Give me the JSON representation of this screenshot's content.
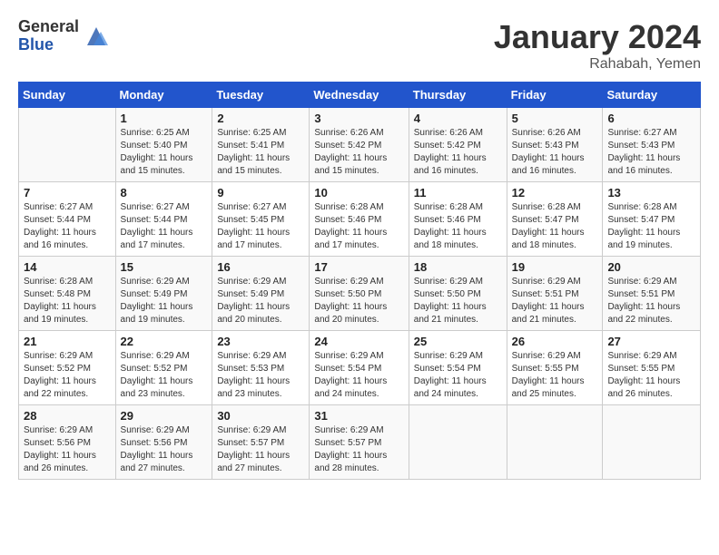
{
  "logo": {
    "general": "General",
    "blue": "Blue"
  },
  "title": "January 2024",
  "location": "Rahabah, Yemen",
  "days_of_week": [
    "Sunday",
    "Monday",
    "Tuesday",
    "Wednesday",
    "Thursday",
    "Friday",
    "Saturday"
  ],
  "weeks": [
    [
      {
        "day": "",
        "sunrise": "",
        "sunset": "",
        "daylight": ""
      },
      {
        "day": "1",
        "sunrise": "6:25 AM",
        "sunset": "5:40 PM",
        "daylight": "11 hours and 15 minutes."
      },
      {
        "day": "2",
        "sunrise": "6:25 AM",
        "sunset": "5:41 PM",
        "daylight": "11 hours and 15 minutes."
      },
      {
        "day": "3",
        "sunrise": "6:26 AM",
        "sunset": "5:42 PM",
        "daylight": "11 hours and 15 minutes."
      },
      {
        "day": "4",
        "sunrise": "6:26 AM",
        "sunset": "5:42 PM",
        "daylight": "11 hours and 16 minutes."
      },
      {
        "day": "5",
        "sunrise": "6:26 AM",
        "sunset": "5:43 PM",
        "daylight": "11 hours and 16 minutes."
      },
      {
        "day": "6",
        "sunrise": "6:27 AM",
        "sunset": "5:43 PM",
        "daylight": "11 hours and 16 minutes."
      }
    ],
    [
      {
        "day": "7",
        "sunrise": "6:27 AM",
        "sunset": "5:44 PM",
        "daylight": "11 hours and 16 minutes."
      },
      {
        "day": "8",
        "sunrise": "6:27 AM",
        "sunset": "5:44 PM",
        "daylight": "11 hours and 17 minutes."
      },
      {
        "day": "9",
        "sunrise": "6:27 AM",
        "sunset": "5:45 PM",
        "daylight": "11 hours and 17 minutes."
      },
      {
        "day": "10",
        "sunrise": "6:28 AM",
        "sunset": "5:46 PM",
        "daylight": "11 hours and 17 minutes."
      },
      {
        "day": "11",
        "sunrise": "6:28 AM",
        "sunset": "5:46 PM",
        "daylight": "11 hours and 18 minutes."
      },
      {
        "day": "12",
        "sunrise": "6:28 AM",
        "sunset": "5:47 PM",
        "daylight": "11 hours and 18 minutes."
      },
      {
        "day": "13",
        "sunrise": "6:28 AM",
        "sunset": "5:47 PM",
        "daylight": "11 hours and 19 minutes."
      }
    ],
    [
      {
        "day": "14",
        "sunrise": "6:28 AM",
        "sunset": "5:48 PM",
        "daylight": "11 hours and 19 minutes."
      },
      {
        "day": "15",
        "sunrise": "6:29 AM",
        "sunset": "5:49 PM",
        "daylight": "11 hours and 19 minutes."
      },
      {
        "day": "16",
        "sunrise": "6:29 AM",
        "sunset": "5:49 PM",
        "daylight": "11 hours and 20 minutes."
      },
      {
        "day": "17",
        "sunrise": "6:29 AM",
        "sunset": "5:50 PM",
        "daylight": "11 hours and 20 minutes."
      },
      {
        "day": "18",
        "sunrise": "6:29 AM",
        "sunset": "5:50 PM",
        "daylight": "11 hours and 21 minutes."
      },
      {
        "day": "19",
        "sunrise": "6:29 AM",
        "sunset": "5:51 PM",
        "daylight": "11 hours and 21 minutes."
      },
      {
        "day": "20",
        "sunrise": "6:29 AM",
        "sunset": "5:51 PM",
        "daylight": "11 hours and 22 minutes."
      }
    ],
    [
      {
        "day": "21",
        "sunrise": "6:29 AM",
        "sunset": "5:52 PM",
        "daylight": "11 hours and 22 minutes."
      },
      {
        "day": "22",
        "sunrise": "6:29 AM",
        "sunset": "5:52 PM",
        "daylight": "11 hours and 23 minutes."
      },
      {
        "day": "23",
        "sunrise": "6:29 AM",
        "sunset": "5:53 PM",
        "daylight": "11 hours and 23 minutes."
      },
      {
        "day": "24",
        "sunrise": "6:29 AM",
        "sunset": "5:54 PM",
        "daylight": "11 hours and 24 minutes."
      },
      {
        "day": "25",
        "sunrise": "6:29 AM",
        "sunset": "5:54 PM",
        "daylight": "11 hours and 24 minutes."
      },
      {
        "day": "26",
        "sunrise": "6:29 AM",
        "sunset": "5:55 PM",
        "daylight": "11 hours and 25 minutes."
      },
      {
        "day": "27",
        "sunrise": "6:29 AM",
        "sunset": "5:55 PM",
        "daylight": "11 hours and 26 minutes."
      }
    ],
    [
      {
        "day": "28",
        "sunrise": "6:29 AM",
        "sunset": "5:56 PM",
        "daylight": "11 hours and 26 minutes."
      },
      {
        "day": "29",
        "sunrise": "6:29 AM",
        "sunset": "5:56 PM",
        "daylight": "11 hours and 27 minutes."
      },
      {
        "day": "30",
        "sunrise": "6:29 AM",
        "sunset": "5:57 PM",
        "daylight": "11 hours and 27 minutes."
      },
      {
        "day": "31",
        "sunrise": "6:29 AM",
        "sunset": "5:57 PM",
        "daylight": "11 hours and 28 minutes."
      },
      {
        "day": "",
        "sunrise": "",
        "sunset": "",
        "daylight": ""
      },
      {
        "day": "",
        "sunrise": "",
        "sunset": "",
        "daylight": ""
      },
      {
        "day": "",
        "sunrise": "",
        "sunset": "",
        "daylight": ""
      }
    ]
  ]
}
